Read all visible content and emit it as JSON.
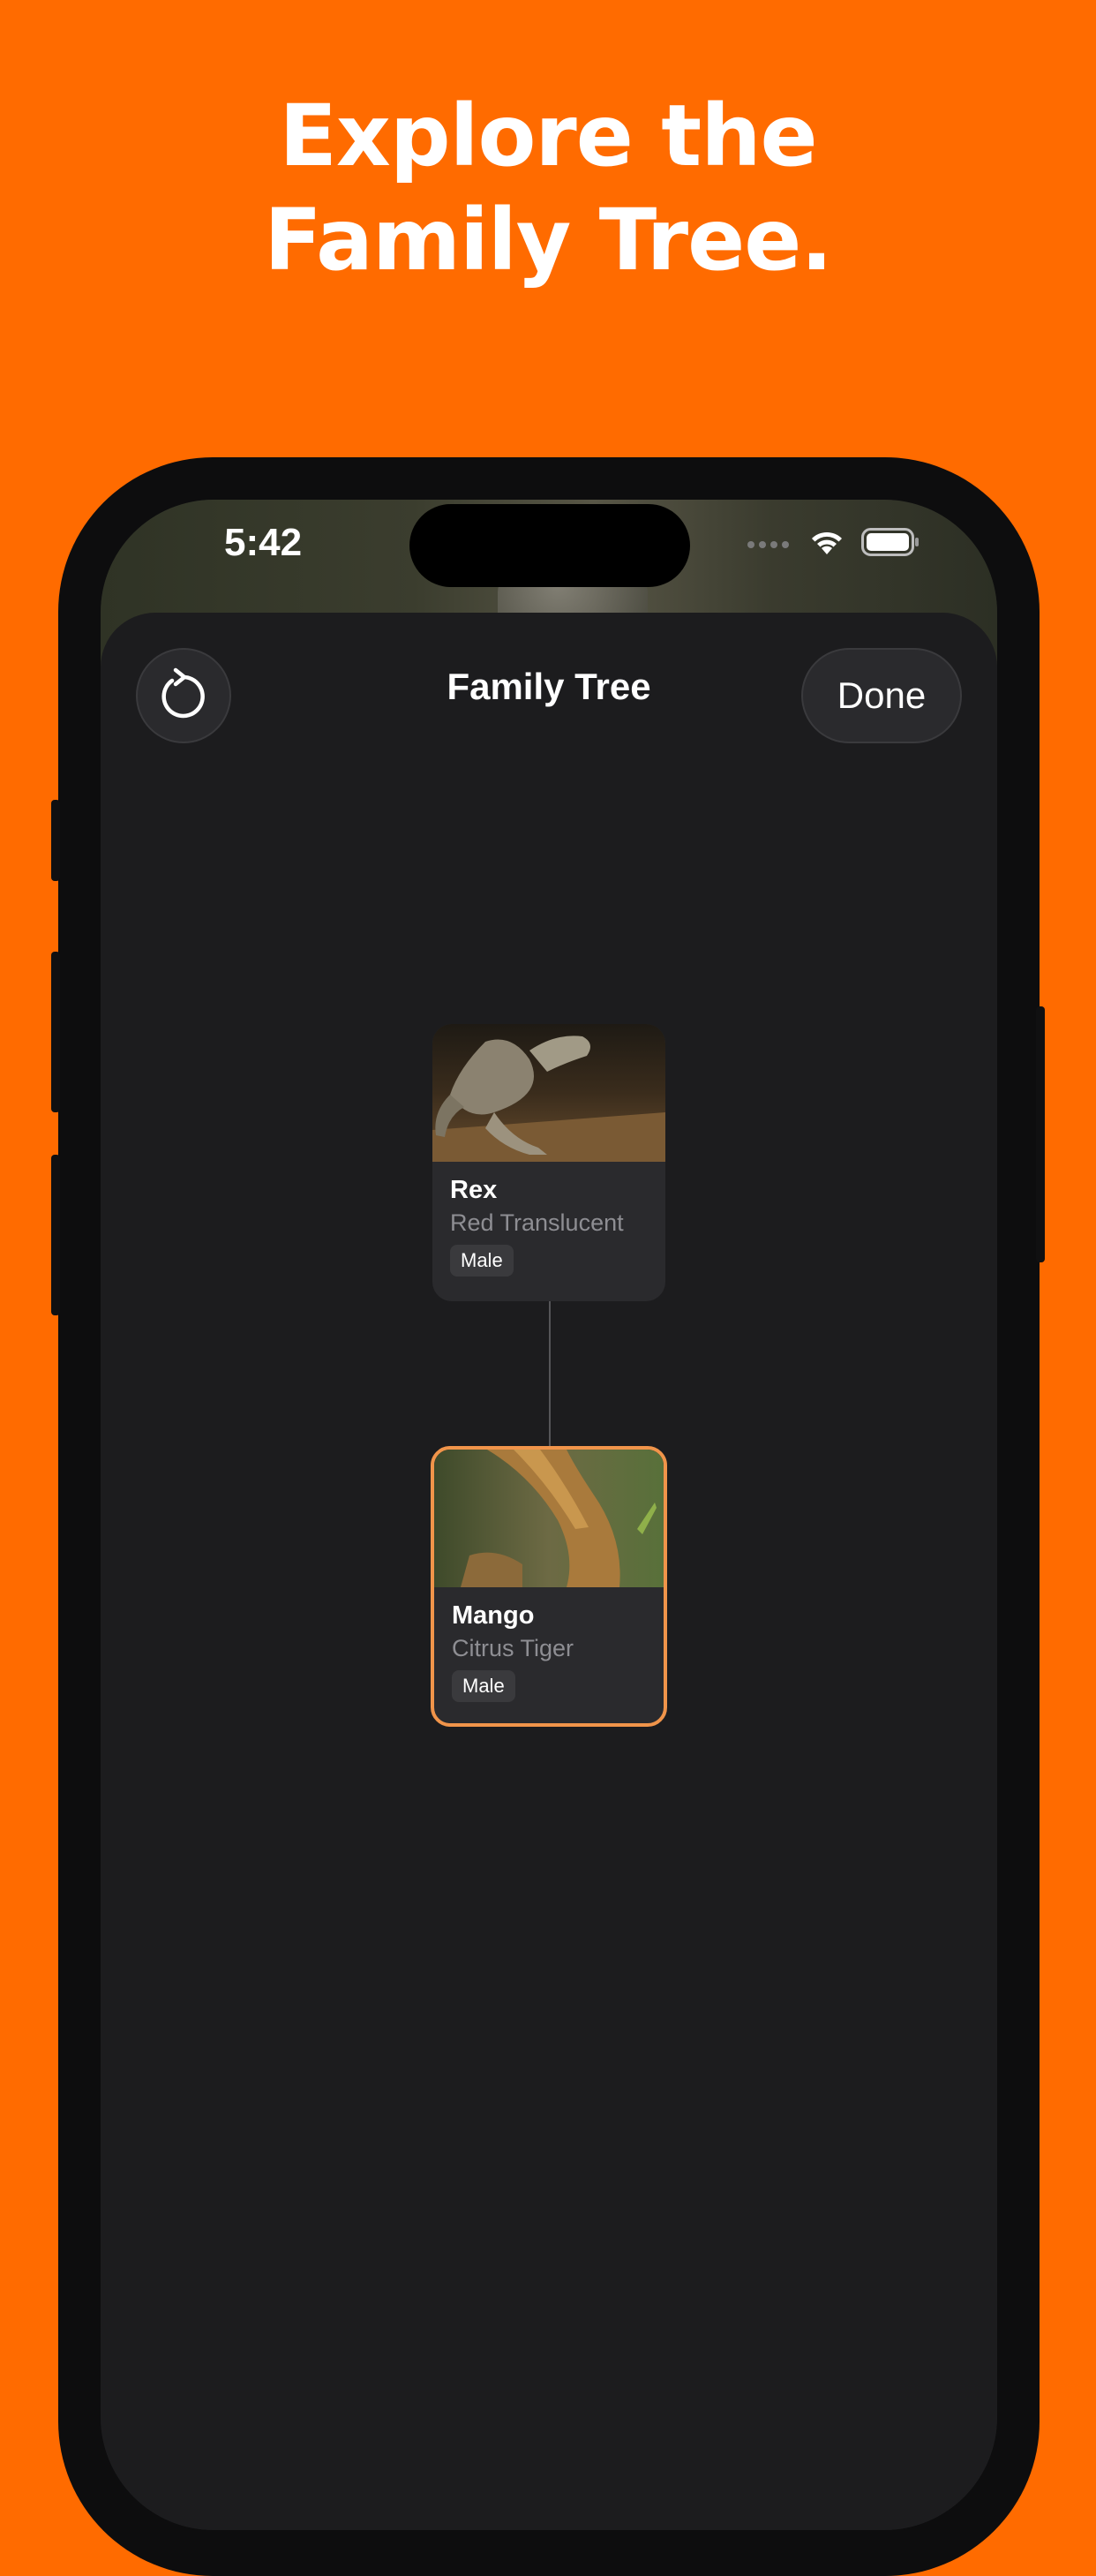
{
  "headline": {
    "line1": "Explore the",
    "line2": "Family Tree."
  },
  "status_bar": {
    "time": "5:42",
    "signal_icon": "cellular-signal-icon",
    "wifi_icon": "wifi-icon",
    "battery_icon": "battery-icon"
  },
  "nav": {
    "title": "Family Tree",
    "reset_icon": "rotate-ccw-icon",
    "done_label": "Done"
  },
  "tree": {
    "parent": {
      "name": "Rex",
      "morph": "Red Translucent",
      "sex": "Male"
    },
    "child": {
      "name": "Mango",
      "morph": "Citrus Tiger",
      "sex": "Male"
    }
  },
  "colors": {
    "background": "#FF6B00",
    "sheet": "#1C1C1E",
    "card": "#2A2A2D",
    "selected_border": "#F0944A"
  }
}
